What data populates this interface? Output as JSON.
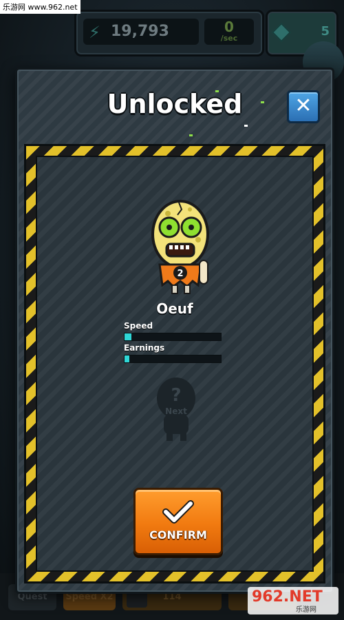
{
  "watermark": {
    "site": "乐游网 www.962.net",
    "logo_big": "962.NET",
    "logo_small": "乐游网"
  },
  "hud": {
    "money": "19,793",
    "rate_value": "0",
    "rate_unit": "/sec",
    "gems": "5"
  },
  "bottom_bar": {
    "quest": "Quest",
    "speed": "Speed X2",
    "count": "114"
  },
  "modal": {
    "title": "Unlocked",
    "close_icon": "close-icon",
    "character": {
      "name": "Oeuf",
      "level": "2",
      "stats": [
        {
          "label": "Speed",
          "fill": 0.07
        },
        {
          "label": "Earnings",
          "fill": 0.05
        }
      ]
    },
    "next": {
      "symbol": "?",
      "label": "Next"
    },
    "confirm": {
      "label": "CONFIRM",
      "icon": "check-icon"
    }
  },
  "colors": {
    "accent_orange": "#f17a10",
    "close_blue": "#3a8ad0",
    "hazard_yellow": "#e3c12a",
    "stat_fill": "#2fd6d6"
  }
}
